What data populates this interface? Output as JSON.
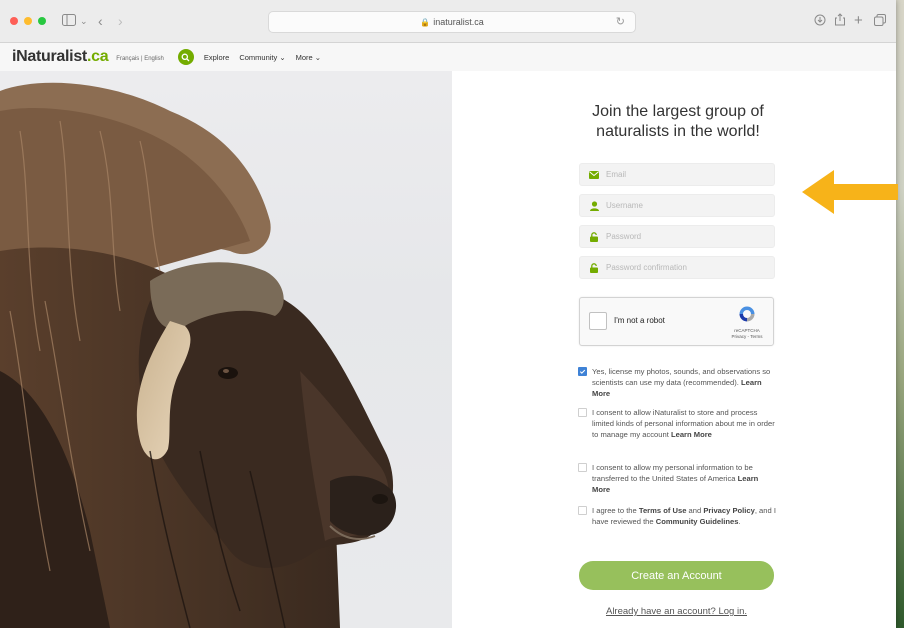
{
  "browser": {
    "url": "inaturalist.ca"
  },
  "site_nav": {
    "logo_prefix": "iNaturalist",
    "logo_suffix": ".ca",
    "language": "Français | English",
    "links": [
      "Explore",
      "Community ⌄",
      "More ⌄"
    ]
  },
  "signup": {
    "heading": "Join the largest group of naturalists in the world!",
    "email_placeholder": "Email",
    "username_placeholder": "Username",
    "password_placeholder": "Password",
    "password_confirm_placeholder": "Password confirmation",
    "captcha_label": "I'm not a robot",
    "captcha_brand": "reCAPTCHA",
    "captcha_links": "Privacy - Terms",
    "consents": [
      {
        "checked": true,
        "text": "Yes, license my photos, sounds, and observations so scientists can use my data (recommended).",
        "link": "Learn More"
      },
      {
        "checked": false,
        "text": "I consent to allow iNaturalist to store and process limited kinds of personal information about me in order to manage my account",
        "link": "Learn More"
      },
      {
        "checked": false,
        "text": "I consent to allow my personal information to be transferred to the United States of America",
        "link": "Learn More"
      }
    ],
    "terms": {
      "checked": false,
      "p1": "I agree to the ",
      "terms_link": "Terms of Use",
      "p2": " and ",
      "privacy_link": "Privacy Policy",
      "p3": ", and I have reviewed the ",
      "guidelines_link": "Community Guidelines",
      "p4": "."
    },
    "create_button": "Create an Account",
    "login_link": "Already have an account? Log in."
  },
  "colors": {
    "brand_green": "#74ac00",
    "button_green": "#97c05c",
    "annotation_arrow": "#f7b319"
  }
}
